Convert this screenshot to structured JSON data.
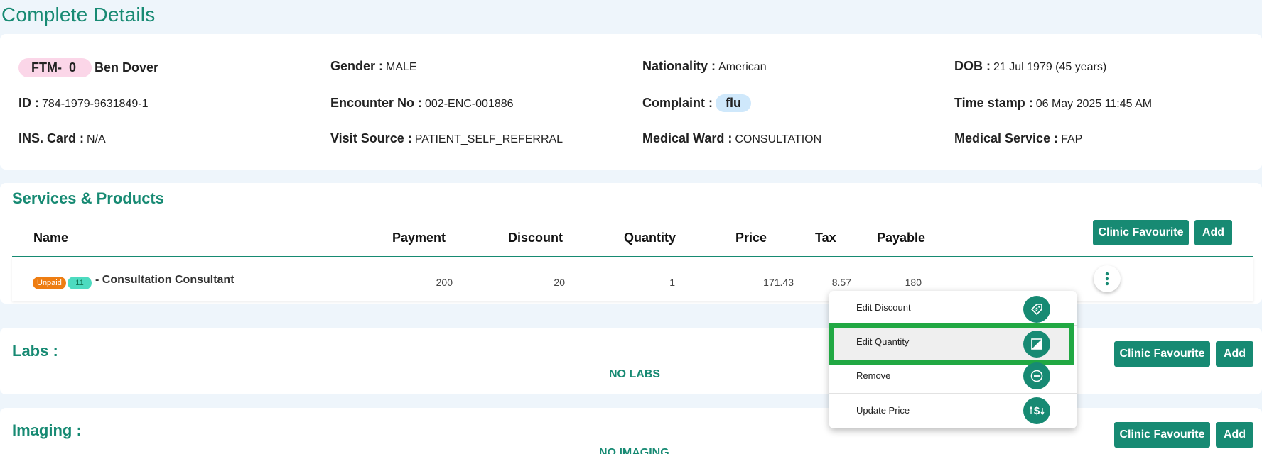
{
  "page_title": "Complete Details",
  "patient": {
    "ftm_label": "FTM-",
    "ftm_count": "0",
    "name": "Ben Dover",
    "gender_label": "Gender :",
    "gender": "MALE",
    "nationality_label": "Nationality :",
    "nationality": "American",
    "dob_label": "DOB :",
    "dob": "21 Jul 1979 (45 years)",
    "id_label": "ID :",
    "id": "784-1979-9631849-1",
    "encounter_label": "Encounter No :",
    "encounter": "002-ENC-001886",
    "complaint_label": "Complaint :",
    "complaint": "flu",
    "timestamp_label": "Time stamp :",
    "timestamp": "06 May 2025 11:45 AM",
    "ins_label": "INS. Card :",
    "ins": "N/A",
    "visit_source_label": "Visit Source :",
    "visit_source": "PATIENT_SELF_REFERRAL",
    "ward_label": "Medical Ward :",
    "ward": "CONSULTATION",
    "service_label": "Medical Service :",
    "service": "FAP"
  },
  "services": {
    "title": "Services & Products",
    "columns": [
      "Name",
      "Payment",
      "Discount",
      "Quantity",
      "Price",
      "Tax",
      "Payable"
    ],
    "clinic_favourite": "Clinic Favourite",
    "add": "Add",
    "rows": [
      {
        "status": "Unpaid",
        "count": "11",
        "name": "- Consultation Consultant",
        "payment": "200",
        "discount": "20",
        "quantity": "1",
        "price": "171.43",
        "tax": "8.57",
        "payable": "180"
      }
    ]
  },
  "labs": {
    "title": "Labs :",
    "empty": "NO LABS",
    "clinic_favourite": "Clinic Favourite",
    "add": "Add"
  },
  "imaging": {
    "title": "Imaging :",
    "empty": "NO IMAGING",
    "clinic_favourite": "Clinic Favourite",
    "add": "Add"
  },
  "context_menu": {
    "items": [
      {
        "label": "Edit Discount",
        "icon": "discount-tag-icon"
      },
      {
        "label": "Edit Quantity",
        "icon": "edit-quantity-icon"
      },
      {
        "label": "Remove",
        "icon": "minus-circle-icon"
      },
      {
        "label": "Update Price",
        "icon": "price-update-icon"
      }
    ]
  },
  "colors": {
    "accent": "#178a73",
    "unpaid": "#ee7d12",
    "highlight": "#21a843"
  }
}
